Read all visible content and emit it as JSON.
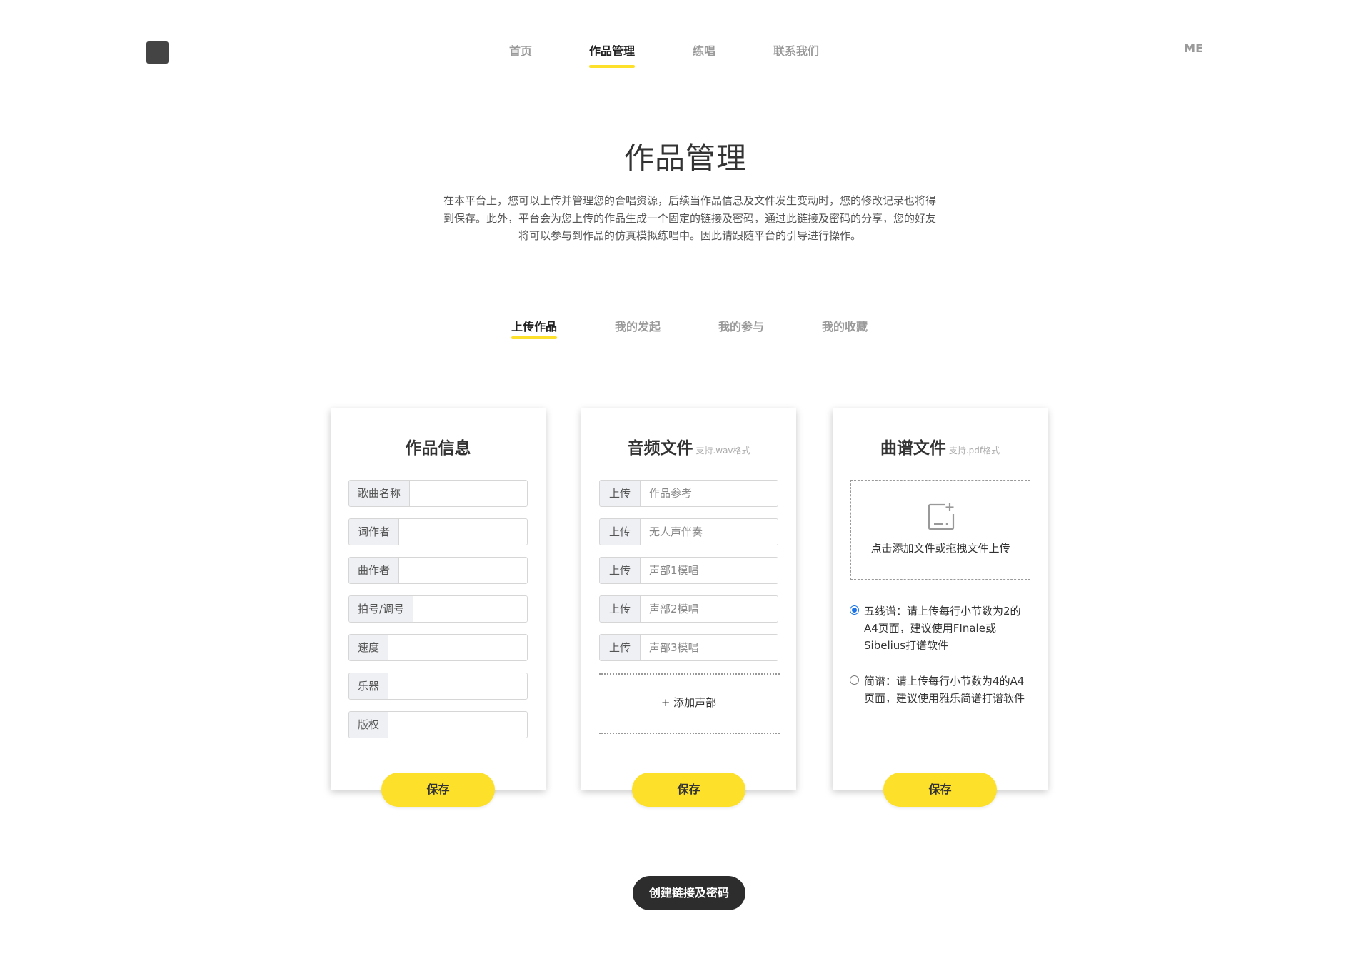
{
  "nav": {
    "items": [
      {
        "label": "首页",
        "active": false
      },
      {
        "label": "作品管理",
        "active": true
      },
      {
        "label": "练唱",
        "active": false
      },
      {
        "label": "联系我们",
        "active": false
      }
    ],
    "me": "ME"
  },
  "header": {
    "title": "作品管理",
    "description": "在本平台上，您可以上传并管理您的合唱资源，后续当作品信息及文件发生变动时，您的修改记录也将得到保存。此外，平台会为您上传的作品生成一个固定的链接及密码，通过此链接及密码的分享，您的好友将可以参与到作品的仿真模拟练唱中。因此请跟随平台的引导进行操作。"
  },
  "subtabs": [
    {
      "label": "上传作品",
      "active": true
    },
    {
      "label": "我的发起",
      "active": false
    },
    {
      "label": "我的参与",
      "active": false
    },
    {
      "label": "我的收藏",
      "active": false
    }
  ],
  "info_card": {
    "title": "作品信息",
    "fields": [
      {
        "label": "歌曲名称",
        "value": ""
      },
      {
        "label": "词作者",
        "value": ""
      },
      {
        "label": "曲作者",
        "value": ""
      },
      {
        "label": "拍号/调号",
        "value": ""
      },
      {
        "label": "速度",
        "value": ""
      },
      {
        "label": "乐器",
        "value": ""
      },
      {
        "label": "版权",
        "value": ""
      }
    ],
    "save_label": "保存"
  },
  "audio_card": {
    "title": "音频文件",
    "hint": "支持.wav格式",
    "rows": [
      {
        "button": "上传",
        "placeholder": "作品参考"
      },
      {
        "button": "上传",
        "placeholder": "无人声伴奏"
      },
      {
        "button": "上传",
        "placeholder": "声部1模唱"
      },
      {
        "button": "上传",
        "placeholder": "声部2模唱"
      },
      {
        "button": "上传",
        "placeholder": "声部3模唱"
      }
    ],
    "add_label": "+ 添加声部",
    "save_label": "保存"
  },
  "score_card": {
    "title": "曲谱文件",
    "hint": "支持.pdf格式",
    "dropzone_text": "点击添加文件或拖拽文件上传",
    "dropzone_icon": "image-add-icon",
    "options": [
      {
        "text": "五线谱：请上传每行小节数为2的A4页面，建议使用FInale或Sibelius打谱软件",
        "checked": true
      },
      {
        "text": "简谱：请上传每行小节数为4的A4页面，建议使用雅乐简谱打谱软件",
        "checked": false
      }
    ],
    "save_label": "保存"
  },
  "create_label": "创建链接及密码",
  "colors": {
    "accent_yellow": "#fde02a",
    "dark_button": "#2d2d2d",
    "radio_blue": "#1a73e8"
  }
}
